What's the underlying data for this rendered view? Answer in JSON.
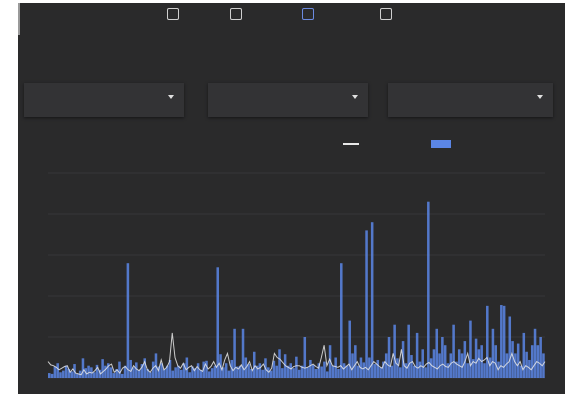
{
  "stepper": {
    "steps": [
      {
        "label": "",
        "active": false
      },
      {
        "label": "",
        "active": false
      },
      {
        "label": "",
        "active": true
      },
      {
        "label": "",
        "active": false
      }
    ]
  },
  "filters": [
    {
      "label": ""
    },
    {
      "label": ""
    },
    {
      "label": ""
    }
  ],
  "colors": {
    "background": "#2a2a2b",
    "panel": "#333335",
    "accent": "#6b8ae0",
    "bar": "#5b86e6",
    "line": "#e8e8e8"
  },
  "chart_data": {
    "type": "bar",
    "ylim": [
      0,
      500
    ],
    "yticks": [
      0,
      100,
      200,
      300,
      400,
      500
    ],
    "ytick_labels": [
      "",
      "",
      "",
      "",
      "",
      ""
    ],
    "grid": true,
    "legend_position": "top-right",
    "series": [
      {
        "name": "",
        "type": "bar",
        "values": [
          12,
          10,
          28,
          36,
          14,
          18,
          30,
          22,
          16,
          34,
          10,
          18,
          48,
          24,
          30,
          26,
          14,
          32,
          20,
          46,
          30,
          36,
          26,
          12,
          22,
          40,
          10,
          30,
          280,
          44,
          26,
          38,
          20,
          34,
          48,
          22,
          14,
          40,
          60,
          28,
          36,
          22,
          30,
          44,
          18,
          26,
          30,
          20,
          36,
          50,
          14,
          28,
          24,
          36,
          20,
          40,
          42,
          16,
          24,
          30,
          270,
          58,
          26,
          36,
          18,
          44,
          120,
          28,
          30,
          120,
          50,
          34,
          22,
          64,
          30,
          36,
          20,
          48,
          26,
          18,
          42,
          30,
          70,
          24,
          58,
          30,
          36,
          24,
          52,
          20,
          30,
          100,
          26,
          44,
          32,
          22,
          36,
          28,
          40,
          16,
          80,
          30,
          50,
          22,
          280,
          36,
          30,
          140,
          60,
          80,
          30,
          50,
          38,
          360,
          50,
          380,
          34,
          44,
          26,
          40,
          60,
          100,
          30,
          130,
          48,
          26,
          90,
          36,
          130,
          56,
          30,
          110,
          40,
          70,
          26,
          430,
          48,
          70,
          120,
          60,
          100,
          80,
          36,
          60,
          130,
          40,
          70,
          60,
          90,
          36,
          140,
          46,
          96,
          70,
          80,
          36,
          176,
          50,
          120,
          80,
          40,
          178,
          176,
          60,
          150,
          90,
          60,
          84,
          30,
          110,
          64,
          44,
          80,
          120,
          80,
          100,
          60
        ]
      },
      {
        "name": "",
        "type": "line",
        "values": [
          40,
          32,
          30,
          26,
          20,
          24,
          28,
          30,
          14,
          22,
          12,
          10,
          8,
          20,
          10,
          14,
          12,
          18,
          26,
          10,
          16,
          22,
          30,
          34,
          14,
          20,
          12,
          24,
          28,
          20,
          16,
          30,
          22,
          18,
          26,
          40,
          20,
          14,
          24,
          30,
          18,
          44,
          20,
          26,
          40,
          110,
          50,
          30,
          24,
          36,
          20,
          26,
          30,
          18,
          28,
          20,
          16,
          34,
          22,
          28,
          40,
          26,
          36,
          20,
          44,
          60,
          30,
          18,
          26,
          22,
          32,
          20,
          28,
          40,
          18,
          30,
          22,
          26,
          34,
          20,
          14,
          24,
          60,
          50,
          46,
          38,
          30,
          26,
          22,
          28,
          30,
          30,
          26,
          24,
          26,
          30,
          34,
          28,
          24,
          50,
          80,
          30,
          46,
          30,
          28,
          26,
          30,
          22,
          28,
          34,
          20,
          30,
          40,
          26,
          22,
          26,
          20,
          30,
          40,
          34,
          28,
          24,
          40,
          32,
          28,
          60,
          36,
          30,
          70,
          30,
          24,
          36,
          40,
          28,
          24,
          30,
          26,
          34,
          38,
          30,
          26,
          22,
          30,
          34,
          28,
          26,
          36,
          40,
          34,
          30,
          26,
          40,
          60,
          30,
          40,
          36,
          48,
          40,
          44,
          50,
          30,
          40,
          36,
          20,
          30,
          26,
          34,
          40,
          60,
          40,
          30,
          40,
          20,
          30,
          26,
          20,
          30,
          40,
          36,
          30,
          40
        ]
      }
    ]
  }
}
